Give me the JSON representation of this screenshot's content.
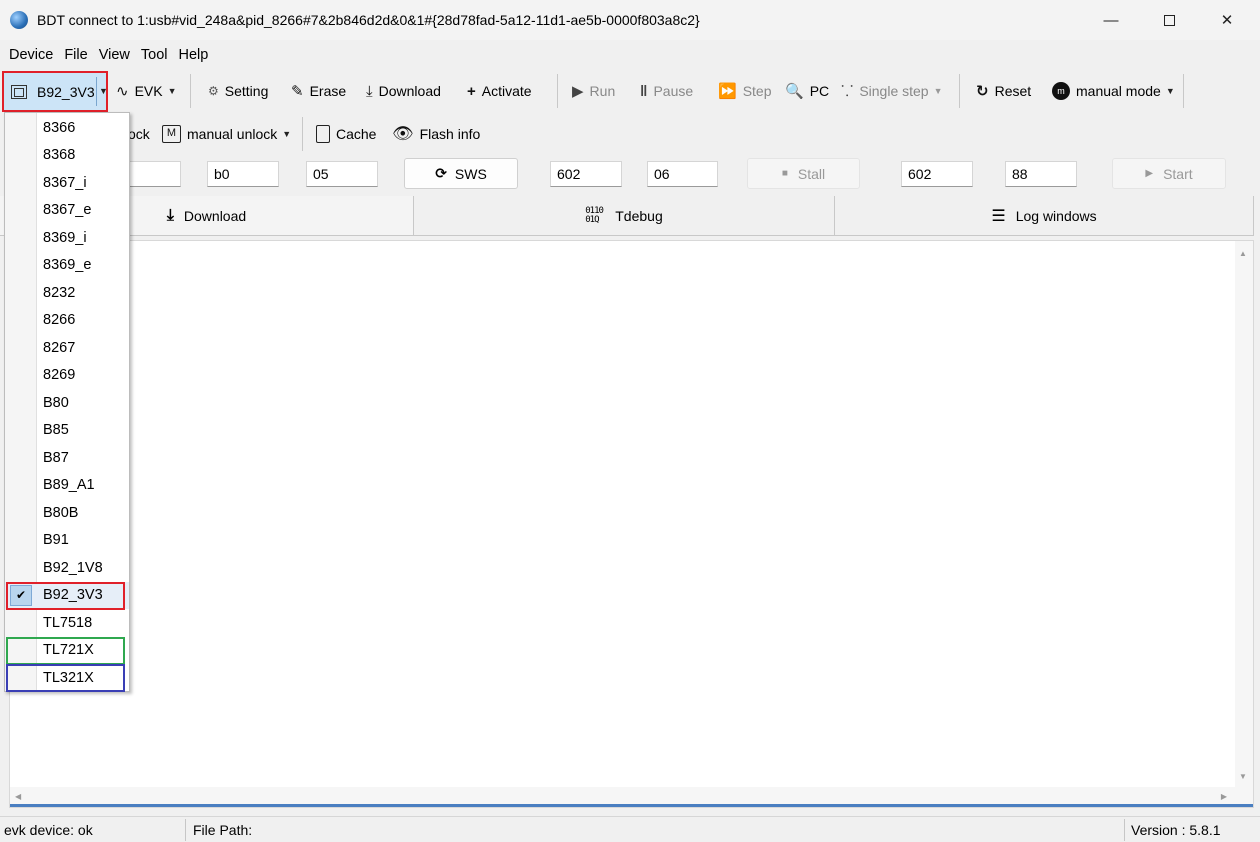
{
  "window": {
    "title": "BDT connect to 1:usb#vid_248a&pid_8266#7&2b846d2d&0&1#{28d78fad-5a12-11d1-ae5b-0000f803a8c2}",
    "minimize_glyph": "—",
    "close_glyph": "✕"
  },
  "menu": [
    "Device",
    "File",
    "View",
    "Tool",
    "Help"
  ],
  "toolbar1": {
    "chip_selector": "B92_3V3",
    "evk": "EVK",
    "setting": "Setting",
    "erase": "Erase",
    "download": "Download",
    "activate": "Activate",
    "run": "Run",
    "pause": "Pause",
    "step": "Step",
    "pc": "PC",
    "single_step": "Single step",
    "reset": "Reset",
    "manual_mode": "manual mode"
  },
  "toolbar2": {
    "unlock_partial": "ock",
    "manual_unlock": "manual unlock",
    "cache": "Cache",
    "flash_info": "Flash info"
  },
  "row3": {
    "input2": "b0",
    "input3": "05",
    "sws": "SWS",
    "input4": "602",
    "input5": "06",
    "stall": "Stall",
    "input6": "602",
    "input7": "88",
    "start": "Start"
  },
  "tabs": [
    "Download",
    "Tdebug",
    "Log windows"
  ],
  "dropdown": {
    "selected": "B92_3V3",
    "items": [
      "8366",
      "8368",
      "8367_i",
      "8367_e",
      "8369_i",
      "8369_e",
      "8232",
      "8266",
      "8267",
      "8269",
      "B80",
      "B85",
      "B87",
      "B89_A1",
      "B80B",
      "B91",
      "B92_1V8",
      "B92_3V3",
      "TL7518",
      "TL721X",
      "TL321X"
    ],
    "check_glyph": "✔"
  },
  "status": {
    "device": "evk device: ok",
    "file_path": "File Path:",
    "version": "Version : 5.8.1"
  },
  "colors": {
    "highlight_red": "#e0202a",
    "highlight_green": "#2fa84f",
    "highlight_blue": "#3a3fb5",
    "selection": "#cce4f7"
  }
}
